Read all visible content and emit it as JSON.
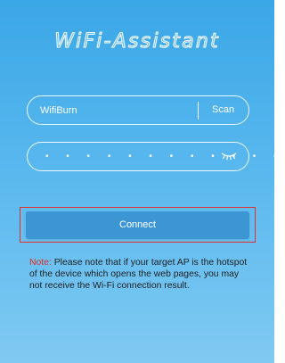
{
  "app": {
    "title": "WiFi-Assistant"
  },
  "ssid": {
    "value": "WifiBurn",
    "scan_label": "Scan"
  },
  "password": {
    "masked_value": "• • • • • • • • • • • •",
    "visibility_icon": "eye-closed-icon"
  },
  "connect": {
    "label": "Connect"
  },
  "note": {
    "label": "Note:",
    "text": " Please note that if your target AP is the hotspot of the device which opens the web pages, you may not receive the Wi-Fi connection result."
  },
  "colors": {
    "background_top": "#3aa7e6",
    "background_bottom": "#7fcaf2",
    "button": "#3d96d4",
    "highlight": "#e0302a",
    "note_text": "#1f1f1f"
  }
}
